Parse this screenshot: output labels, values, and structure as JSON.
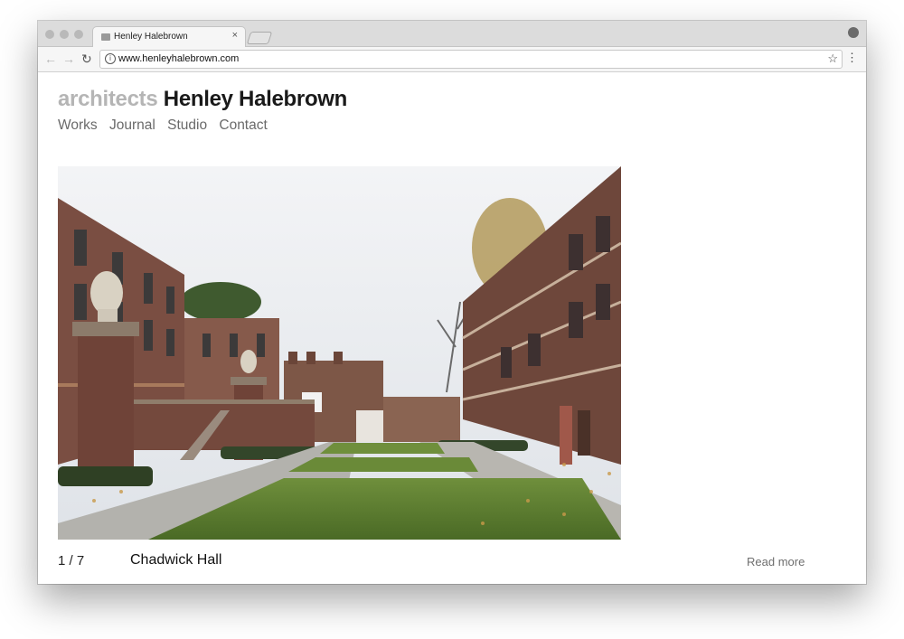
{
  "browser": {
    "tab_title": "Henley Halebrown",
    "tab_close": "×",
    "url": "www.henleyhalebrown.com",
    "back_glyph": "←",
    "forward_glyph": "→",
    "reload_glyph": "↻",
    "info_glyph": "i",
    "star_glyph": "☆",
    "menu_glyph": "⋮"
  },
  "site": {
    "title_prefix": "architects",
    "title_name": "Henley Halebrown",
    "nav": [
      "Works",
      "Journal",
      "Studio",
      "Contact"
    ]
  },
  "slideshow": {
    "counter": "1 / 7",
    "caption": "Chadwick Hall",
    "read_more": "Read more"
  },
  "colors": {
    "muted_title": "#b5b5b5",
    "nav_text": "#6a6a6a",
    "brick": "#7a4e42"
  }
}
